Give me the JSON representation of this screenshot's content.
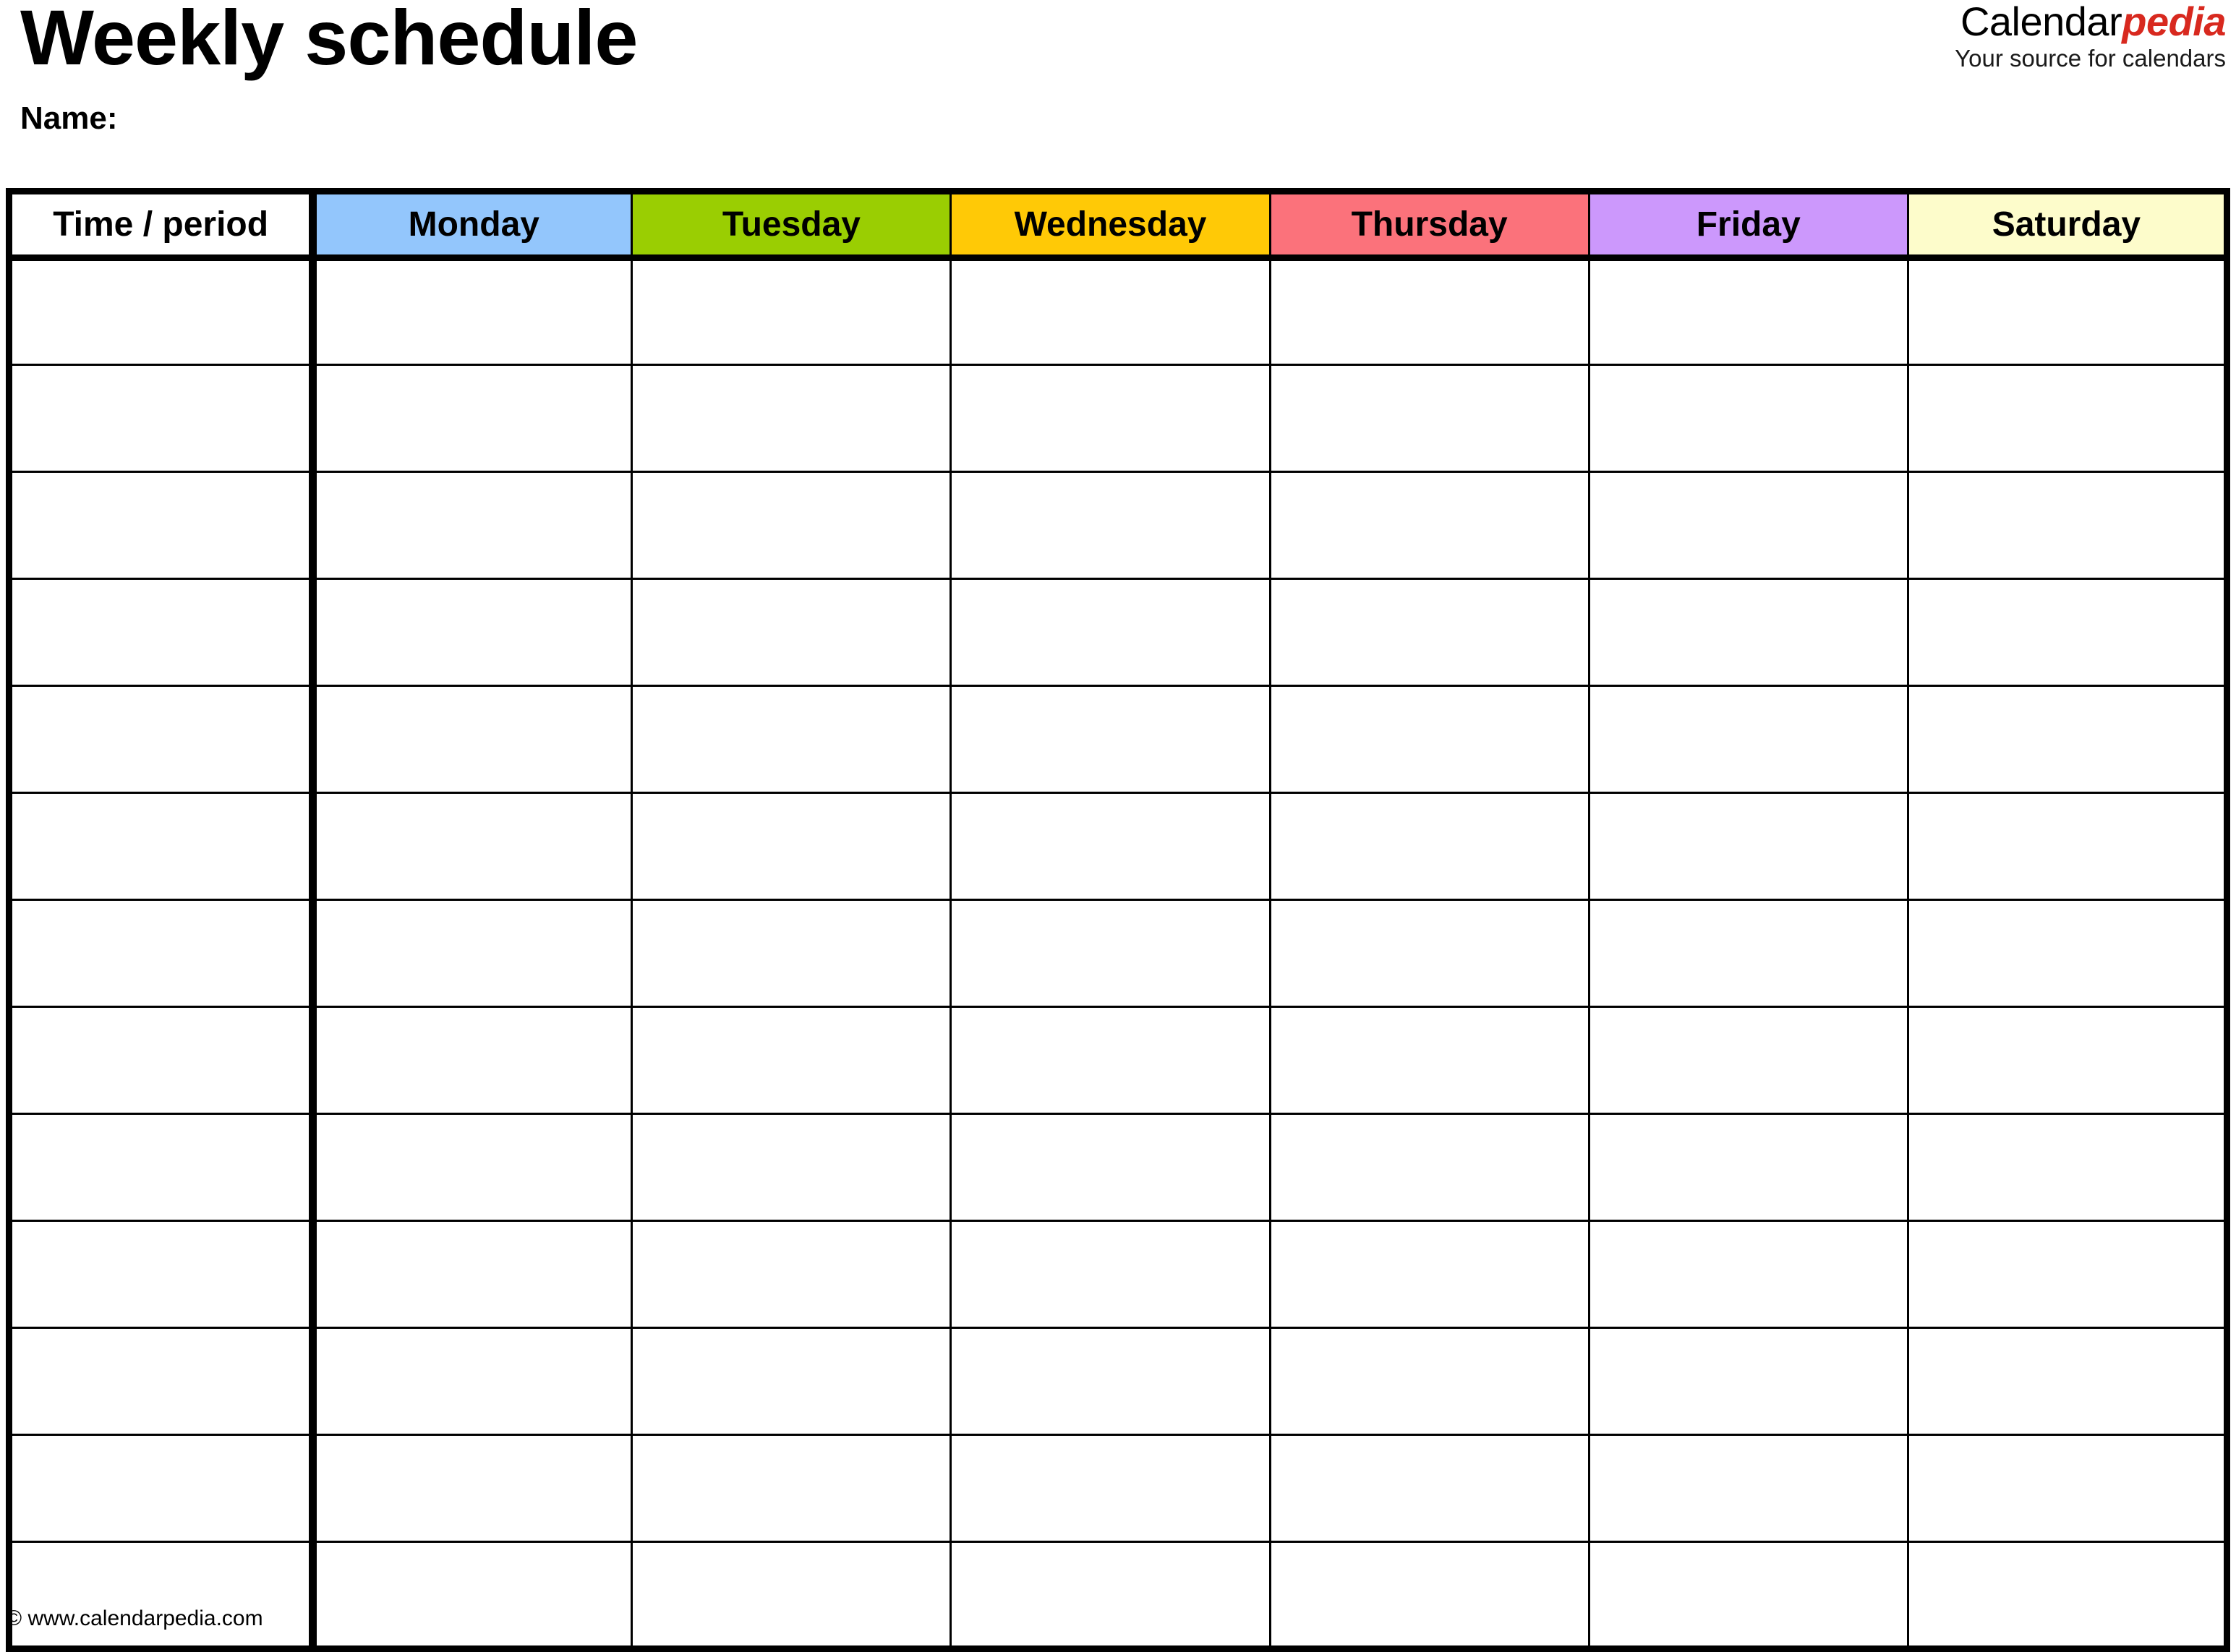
{
  "document": {
    "title": "Weekly schedule",
    "name_label": "Name:"
  },
  "brand": {
    "word_primary": "Calendar",
    "word_accent": "pedia",
    "tagline": "Your source for calendars",
    "accent_color": "#d8291f"
  },
  "table": {
    "columns": [
      {
        "label": "Time / period",
        "bg": "#ffffff",
        "key": "time"
      },
      {
        "label": "Monday",
        "bg": "#93c6fc",
        "key": "monday"
      },
      {
        "label": "Tuesday",
        "bg": "#9ace02",
        "key": "tuesday"
      },
      {
        "label": "Wednesday",
        "bg": "#ffc906",
        "key": "wednesday"
      },
      {
        "label": "Thursday",
        "bg": "#fb727b",
        "key": "thursday"
      },
      {
        "label": "Friday",
        "bg": "#cc98fc",
        "key": "friday"
      },
      {
        "label": "Saturday",
        "bg": "#fdfccb",
        "key": "saturday"
      }
    ],
    "row_count": 13,
    "rows": [
      {
        "time": "",
        "monday": "",
        "tuesday": "",
        "wednesday": "",
        "thursday": "",
        "friday": "",
        "saturday": ""
      },
      {
        "time": "",
        "monday": "",
        "tuesday": "",
        "wednesday": "",
        "thursday": "",
        "friday": "",
        "saturday": ""
      },
      {
        "time": "",
        "monday": "",
        "tuesday": "",
        "wednesday": "",
        "thursday": "",
        "friday": "",
        "saturday": ""
      },
      {
        "time": "",
        "monday": "",
        "tuesday": "",
        "wednesday": "",
        "thursday": "",
        "friday": "",
        "saturday": ""
      },
      {
        "time": "",
        "monday": "",
        "tuesday": "",
        "wednesday": "",
        "thursday": "",
        "friday": "",
        "saturday": ""
      },
      {
        "time": "",
        "monday": "",
        "tuesday": "",
        "wednesday": "",
        "thursday": "",
        "friday": "",
        "saturday": ""
      },
      {
        "time": "",
        "monday": "",
        "tuesday": "",
        "wednesday": "",
        "thursday": "",
        "friday": "",
        "saturday": ""
      },
      {
        "time": "",
        "monday": "",
        "tuesday": "",
        "wednesday": "",
        "thursday": "",
        "friday": "",
        "saturday": ""
      },
      {
        "time": "",
        "monday": "",
        "tuesday": "",
        "wednesday": "",
        "thursday": "",
        "friday": "",
        "saturday": ""
      },
      {
        "time": "",
        "monday": "",
        "tuesday": "",
        "wednesday": "",
        "thursday": "",
        "friday": "",
        "saturday": ""
      },
      {
        "time": "",
        "monday": "",
        "tuesday": "",
        "wednesday": "",
        "thursday": "",
        "friday": "",
        "saturday": ""
      },
      {
        "time": "",
        "monday": "",
        "tuesday": "",
        "wednesday": "",
        "thursday": "",
        "friday": "",
        "saturday": ""
      },
      {
        "time": "",
        "monday": "",
        "tuesday": "",
        "wednesday": "",
        "thursday": "",
        "friday": "",
        "saturday": ""
      }
    ]
  },
  "footer": {
    "credit": "© www.calendarpedia.com"
  }
}
